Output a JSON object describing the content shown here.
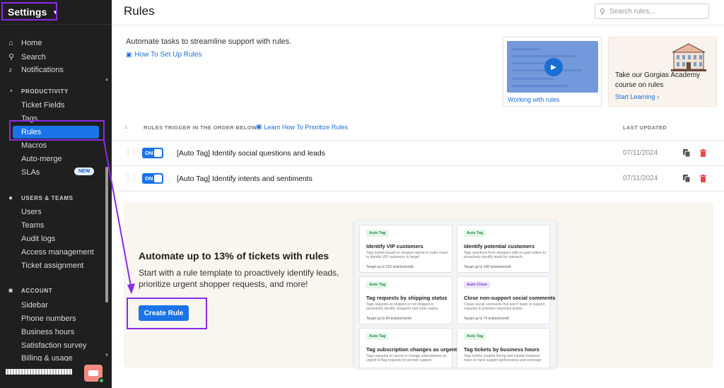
{
  "sidebar": {
    "title": "Settings",
    "top_items": [
      {
        "label": "Home",
        "icon": "home-icon"
      },
      {
        "label": "Search",
        "icon": "search-icon"
      },
      {
        "label": "Notifications",
        "icon": "bell-icon"
      }
    ],
    "sections": [
      {
        "label": "PRODUCTIVITY",
        "icon": "gauge-icon",
        "items": [
          "Ticket Fields",
          "Tags",
          "Rules",
          "Macros",
          "Auto-merge",
          "SLAs"
        ]
      },
      {
        "label": "USERS & TEAMS",
        "icon": "users-icon",
        "items": [
          "Users",
          "Teams",
          "Audit logs",
          "Access management",
          "Ticket assignment"
        ]
      },
      {
        "label": "ACCOUNT",
        "icon": "briefcase-icon",
        "items": [
          "Sidebar",
          "Phone numbers",
          "Business hours",
          "Satisfaction survey",
          "Billing & usage"
        ]
      }
    ],
    "active_item": "Rules",
    "sla_badge": "NEW"
  },
  "header": {
    "title": "Rules",
    "search_placeholder": "Search rules..."
  },
  "intro": {
    "text": "Automate tasks to streamline support with rules.",
    "link": "How To Set Up Rules"
  },
  "video_card": {
    "caption": "Working with rules"
  },
  "academy_card": {
    "text": "Take our Gorgias Academy course on rules",
    "link": "Start Learning"
  },
  "table": {
    "order_label": "RULES TRIGGER IN THE ORDER BELOW",
    "prioritize_link": "Learn How To Prioritize Rules",
    "updated_header": "LAST UPDATED",
    "rows": [
      {
        "toggle": "ON",
        "name": "[Auto Tag] Identify social questions and leads",
        "date": "07/11/2024"
      },
      {
        "toggle": "ON",
        "name": "[Auto Tag] Identify intents and sentiments",
        "date": "07/11/2024"
      }
    ]
  },
  "promo": {
    "title": "Automate up to 13% of tickets with rules",
    "description": "Start with a rule template to proactively identify leads, prioritize urgent shopper requests, and more!",
    "button": "Create Rule",
    "templates": [
      {
        "tag": "Auto Tag",
        "title": "Identify VIP customers",
        "desc": "Tags tickets based on shopper spend or order count to identify VIP customers to target.",
        "target": "Target up to 252 tickets/month"
      },
      {
        "tag": "Auto Tag",
        "title": "Identify potential customers",
        "desc": "Tags questions from shoppers with no past orders to proactively identify leads for outreach.",
        "target": "Target up to 100 tickets/month"
      },
      {
        "tag": "Auto Tag",
        "title": "Tag requests by shipping status",
        "desc": "Tags requests as shipped or not shipped to proactively identify shoppers' last order status.",
        "target": "Target up to 84 tickets/month"
      },
      {
        "tag": "Auto Close",
        "title": "Close non-support social comments",
        "desc": "Closes social comments that aren't leads or support requests to prioritize important tickets.",
        "target": "Target up to 70 tickets/month"
      },
      {
        "tag": "Auto Tag",
        "title": "Tag subscription changes as urgent",
        "desc": "Tags requests to cancel or change subscriptions as urgent to flag requests for prompt support.",
        "target": ""
      },
      {
        "tag": "Auto Tag",
        "title": "Tag tickets by business hours",
        "desc": "Tags tickets created during and outside business hours to track support performance and coverage.",
        "target": ""
      }
    ]
  },
  "colors": {
    "accent": "#1a73e8",
    "sidebar_bg": "#1f1f1f",
    "annotation": "#8a2be2",
    "delete": "#e5484d"
  }
}
